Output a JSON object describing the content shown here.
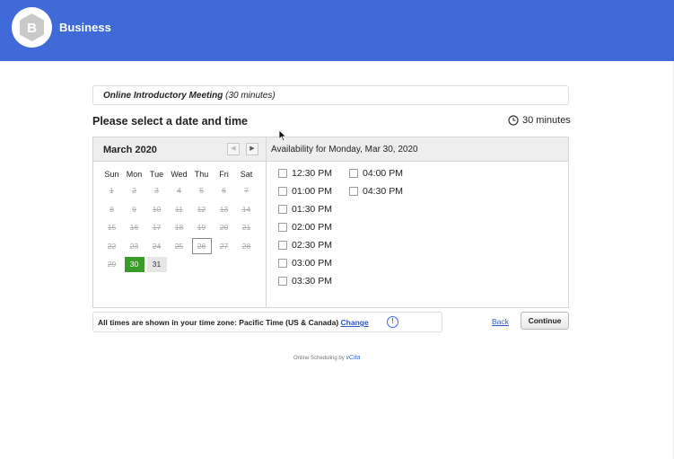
{
  "header": {
    "brand": "Business",
    "logo_letter": "B",
    "color": "#3f6ad8"
  },
  "meeting": {
    "name": "Online Introductory Meeting",
    "duration_text": "(30 minutes)"
  },
  "title": "Please select a date and time",
  "duration": {
    "icon": "clock-icon",
    "label": "30 minutes"
  },
  "calendar": {
    "month": "March 2020",
    "prev_icon": "◀",
    "next_icon": "▶",
    "weekdays": [
      "Sun",
      "Mon",
      "Tue",
      "Wed",
      "Thu",
      "Fri",
      "Sat"
    ],
    "days": [
      {
        "d": "1",
        "state": "past"
      },
      {
        "d": "2",
        "state": "past"
      },
      {
        "d": "3",
        "state": "past"
      },
      {
        "d": "4",
        "state": "past"
      },
      {
        "d": "5",
        "state": "past"
      },
      {
        "d": "6",
        "state": "past"
      },
      {
        "d": "7",
        "state": "past"
      },
      {
        "d": "8",
        "state": "past"
      },
      {
        "d": "9",
        "state": "past"
      },
      {
        "d": "10",
        "state": "past"
      },
      {
        "d": "11",
        "state": "past"
      },
      {
        "d": "12",
        "state": "past"
      },
      {
        "d": "13",
        "state": "past"
      },
      {
        "d": "14",
        "state": "past"
      },
      {
        "d": "15",
        "state": "past"
      },
      {
        "d": "16",
        "state": "past"
      },
      {
        "d": "17",
        "state": "past"
      },
      {
        "d": "18",
        "state": "past"
      },
      {
        "d": "19",
        "state": "past"
      },
      {
        "d": "20",
        "state": "past"
      },
      {
        "d": "21",
        "state": "past"
      },
      {
        "d": "22",
        "state": "past"
      },
      {
        "d": "23",
        "state": "past"
      },
      {
        "d": "24",
        "state": "past"
      },
      {
        "d": "25",
        "state": "past"
      },
      {
        "d": "26",
        "state": "today"
      },
      {
        "d": "27",
        "state": "past"
      },
      {
        "d": "28",
        "state": "past"
      },
      {
        "d": "29",
        "state": "past"
      },
      {
        "d": "30",
        "state": "selected"
      },
      {
        "d": "31",
        "state": "available"
      }
    ],
    "selected_color": "#3a9a2a"
  },
  "availability": {
    "title": "Availability for Monday, Mar 30, 2020",
    "slots_col1": [
      "12:30 PM",
      "01:00 PM",
      "01:30 PM",
      "02:00 PM",
      "02:30 PM",
      "03:00 PM",
      "03:30 PM"
    ],
    "slots_col2": [
      "04:00 PM",
      "04:30 PM"
    ]
  },
  "timezone": {
    "prefix": "All times are shown in your time zone:",
    "zone": "Pacific Time (US & Canada)",
    "change_label": "Change",
    "info_icon": "!"
  },
  "actions": {
    "back_label": "Back",
    "continue_label": "Continue"
  },
  "footer": {
    "text": "Online Scheduling by",
    "brand": "vCita"
  }
}
